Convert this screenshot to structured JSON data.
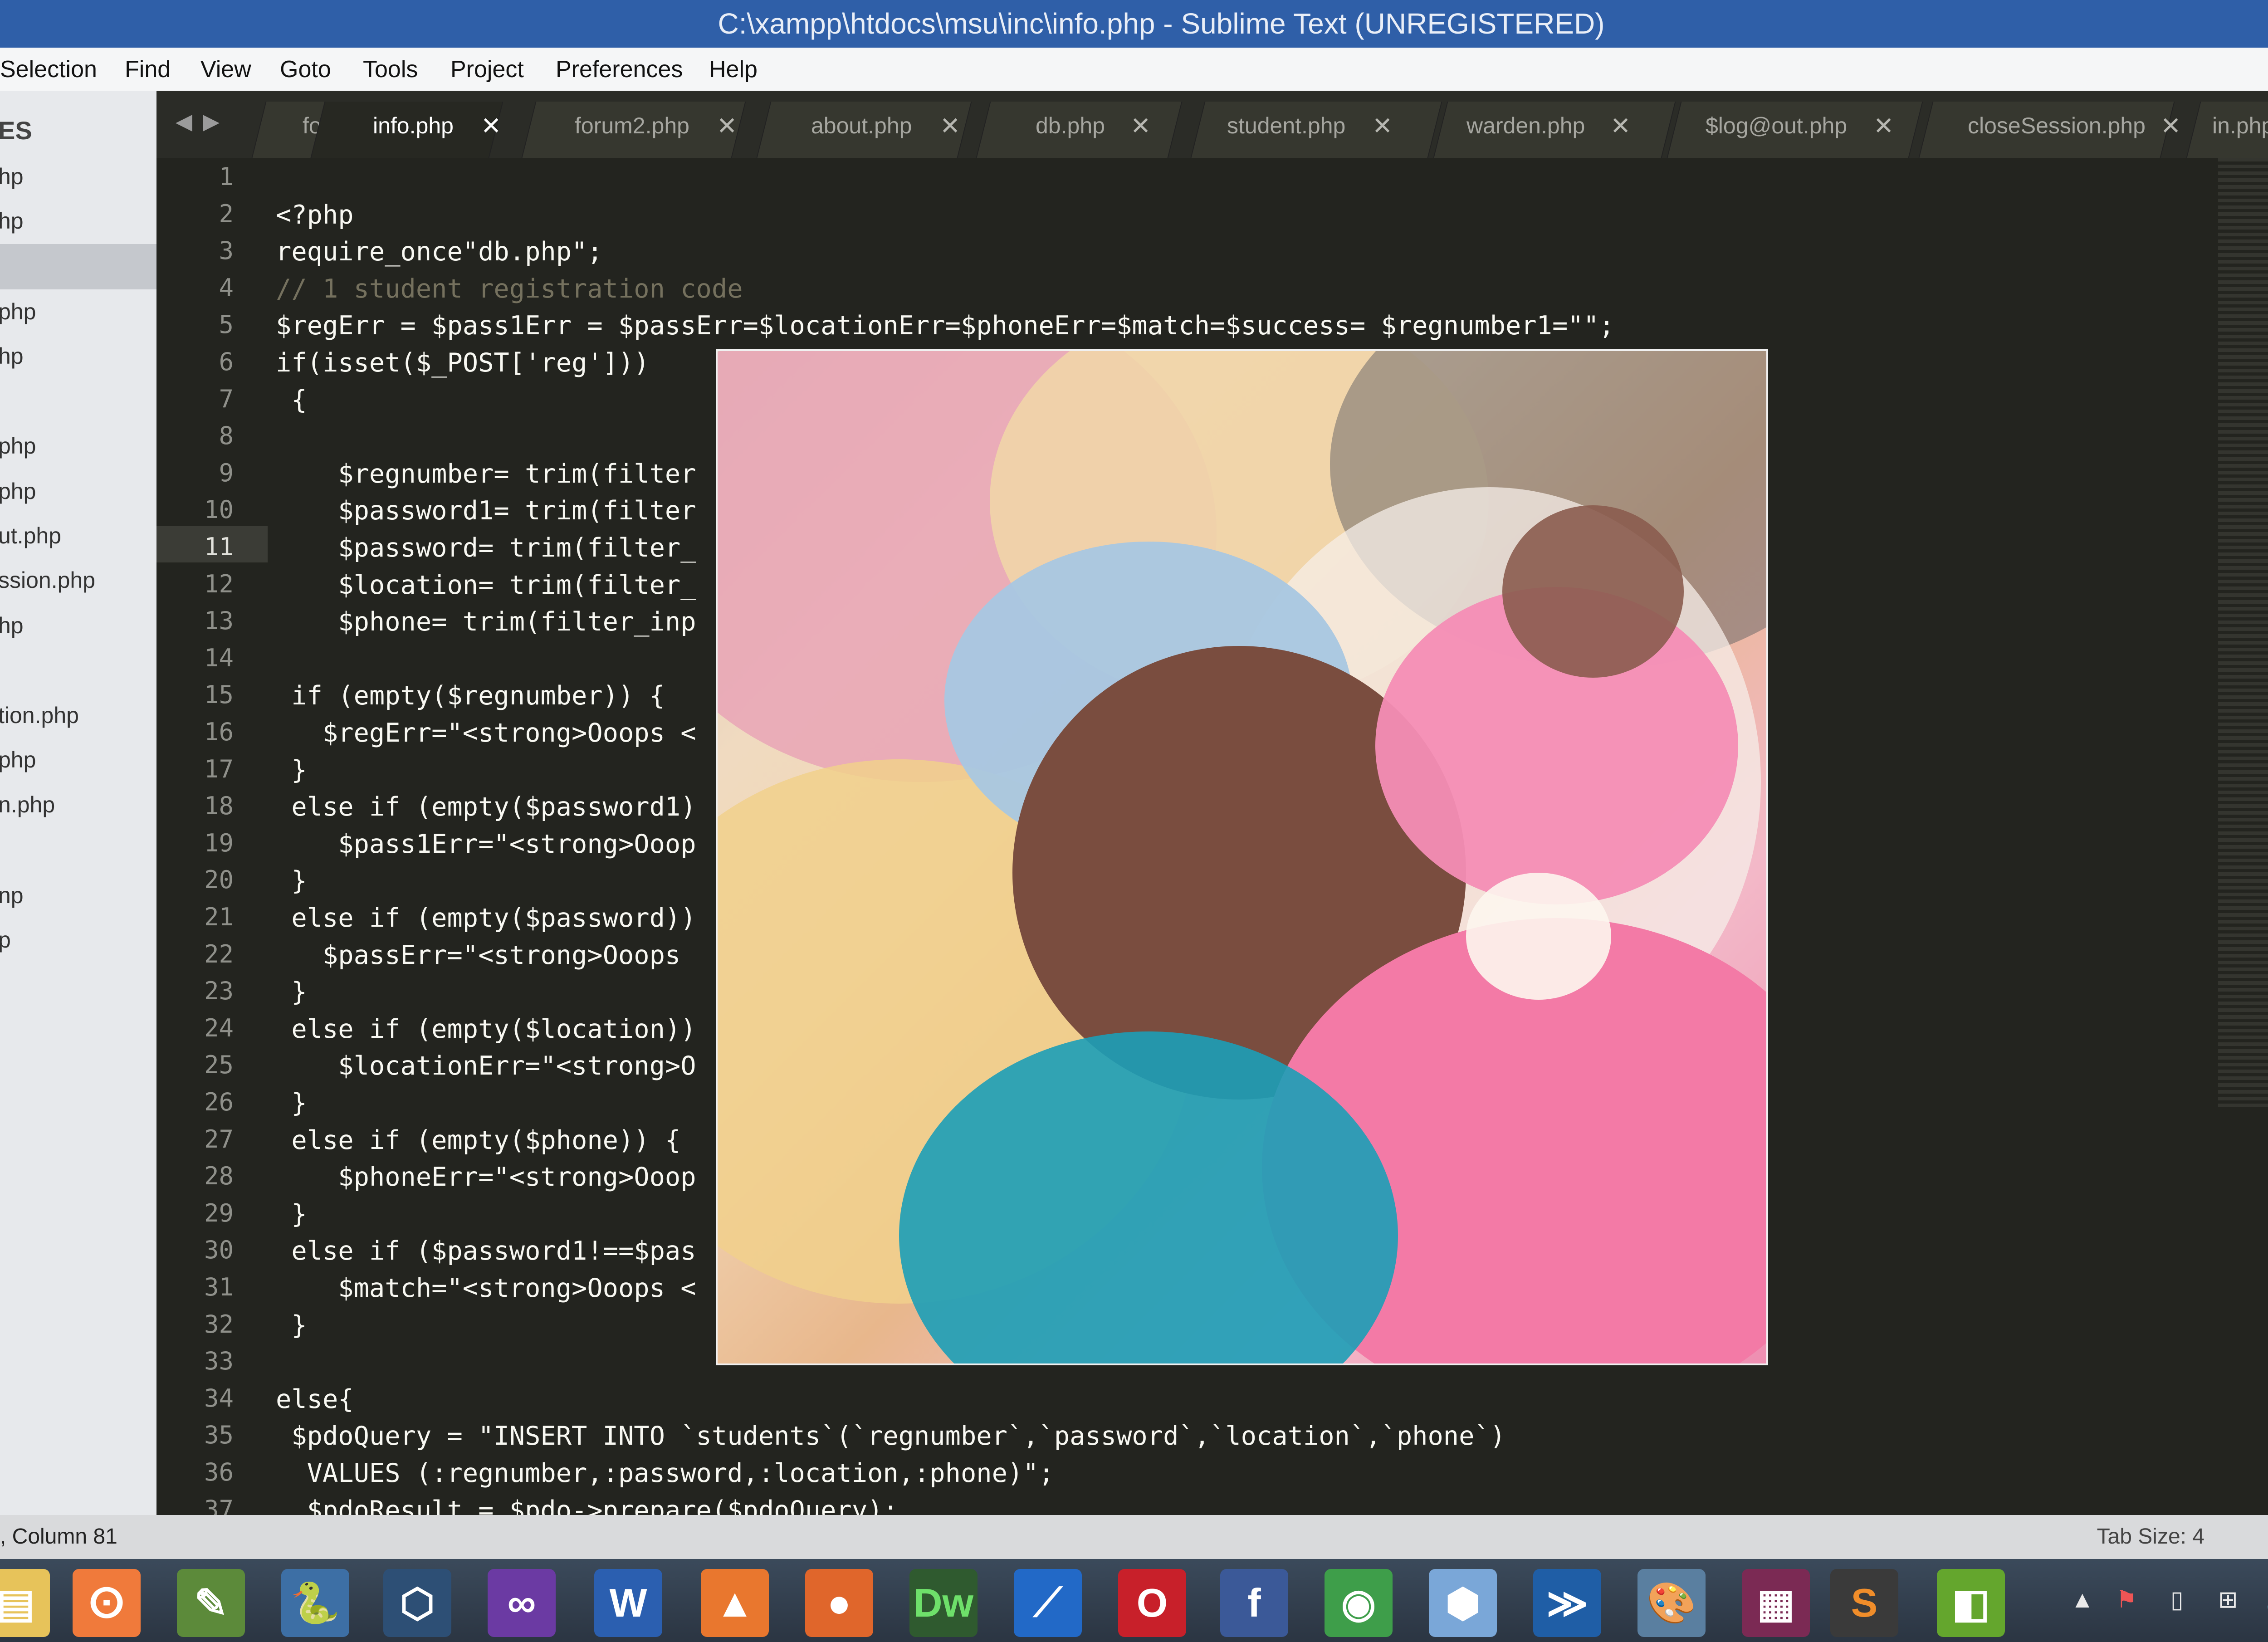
{
  "window": {
    "title": "C:\\xampp\\htdocs\\msu\\inc\\info.php - Sublime Text (UNREGISTERED)"
  },
  "menu": [
    "Selection",
    "Find",
    "View",
    "Goto",
    "Tools",
    "Project",
    "Preferences",
    "Help"
  ],
  "sidebar": {
    "header": "ES",
    "files": [
      "hp",
      "hp",
      "",
      "php",
      "hp",
      "",
      "php",
      "php",
      "ut.php",
      "ssion.php",
      "hp",
      "",
      "tion.php",
      "php",
      "n.php",
      "",
      "np",
      "p"
    ]
  },
  "tabs": [
    {
      "label": "foot",
      "active": false
    },
    {
      "label": "info.php",
      "active": true
    },
    {
      "label": "forum2.php",
      "active": false
    },
    {
      "label": "about.php",
      "active": false
    },
    {
      "label": "db.php",
      "active": false
    },
    {
      "label": "student.php",
      "active": false
    },
    {
      "label": "warden.php",
      "active": false
    },
    {
      "label": "$log@out.php",
      "active": false
    },
    {
      "label": "closeSession.php",
      "active": false
    },
    {
      "label": "in.php",
      "active": false
    }
  ],
  "editor": {
    "current_line": 11,
    "lines": [
      "",
      "<?php",
      "require_once\"db.php\";",
      "// 1 student registration code",
      "$regErr = $pass1Err = $passErr=$locationErr=$phoneErr=$match=$success= $regnumber1=\"\";",
      "if(isset($_POST['reg']))",
      " {",
      "",
      "    $regnumber= trim(filter",
      "    $password1= trim(filter",
      "    $password= trim(filter_",
      "    $location= trim(filter_",
      "    $phone= trim(filter_inp",
      "",
      " if (empty($regnumber)) {",
      "   $regErr=\"<strong>Ooops <",
      " }",
      " else if (empty($password1)",
      "    $pass1Err=\"<strong>Ooop",
      " }",
      " else if (empty($password))",
      "   $passErr=\"<strong>Ooops ",
      " }",
      " else if (empty($location))",
      "    $locationErr=\"<strong>O",
      " }",
      " else if (empty($phone)) {",
      "    $phoneErr=\"<strong>Ooop",
      " }",
      " else if ($password1!==$pas",
      "    $match=\"<strong>Ooops <",
      " }",
      "",
      "else{",
      " $pdoQuery = \"INSERT INTO `students`(`regnumber`,`password`,`location`,`phone`)",
      "  VALUES (:regnumber,:password,:location,:phone)\";",
      "  $pdoResult = $pdo->prepare($pdoQuery);"
    ]
  },
  "statusbar": {
    "position": ", Column 81",
    "tab_size": "Tab Size: 4"
  },
  "taskbar": {
    "apps": [
      "file-explorer-icon",
      "xampp-icon",
      "notepad-icon",
      "python-icon",
      "3d-box-icon",
      "visual-studio-icon",
      "word-icon",
      "vlc-icon",
      "firefox-icon",
      "dreamweaver-icon",
      "text-editor-icon",
      "opera-icon",
      "facebook-icon",
      "chrome-icon",
      "virtual-box-icon",
      "powershell-icon",
      "paint-icon",
      "winrar-icon",
      "sublime-text-icon",
      "layers-icon"
    ],
    "labels": {
      "word": "W",
      "dreamweaver": "Dw",
      "facebook": "f",
      "sublime": "S"
    }
  },
  "colors": {
    "titlebar": "#2f5fa8",
    "editor_bg": "#23241f",
    "keyword": "#f92672",
    "string": "#e6db74",
    "function": "#66d9ef",
    "comment": "#75715e"
  }
}
